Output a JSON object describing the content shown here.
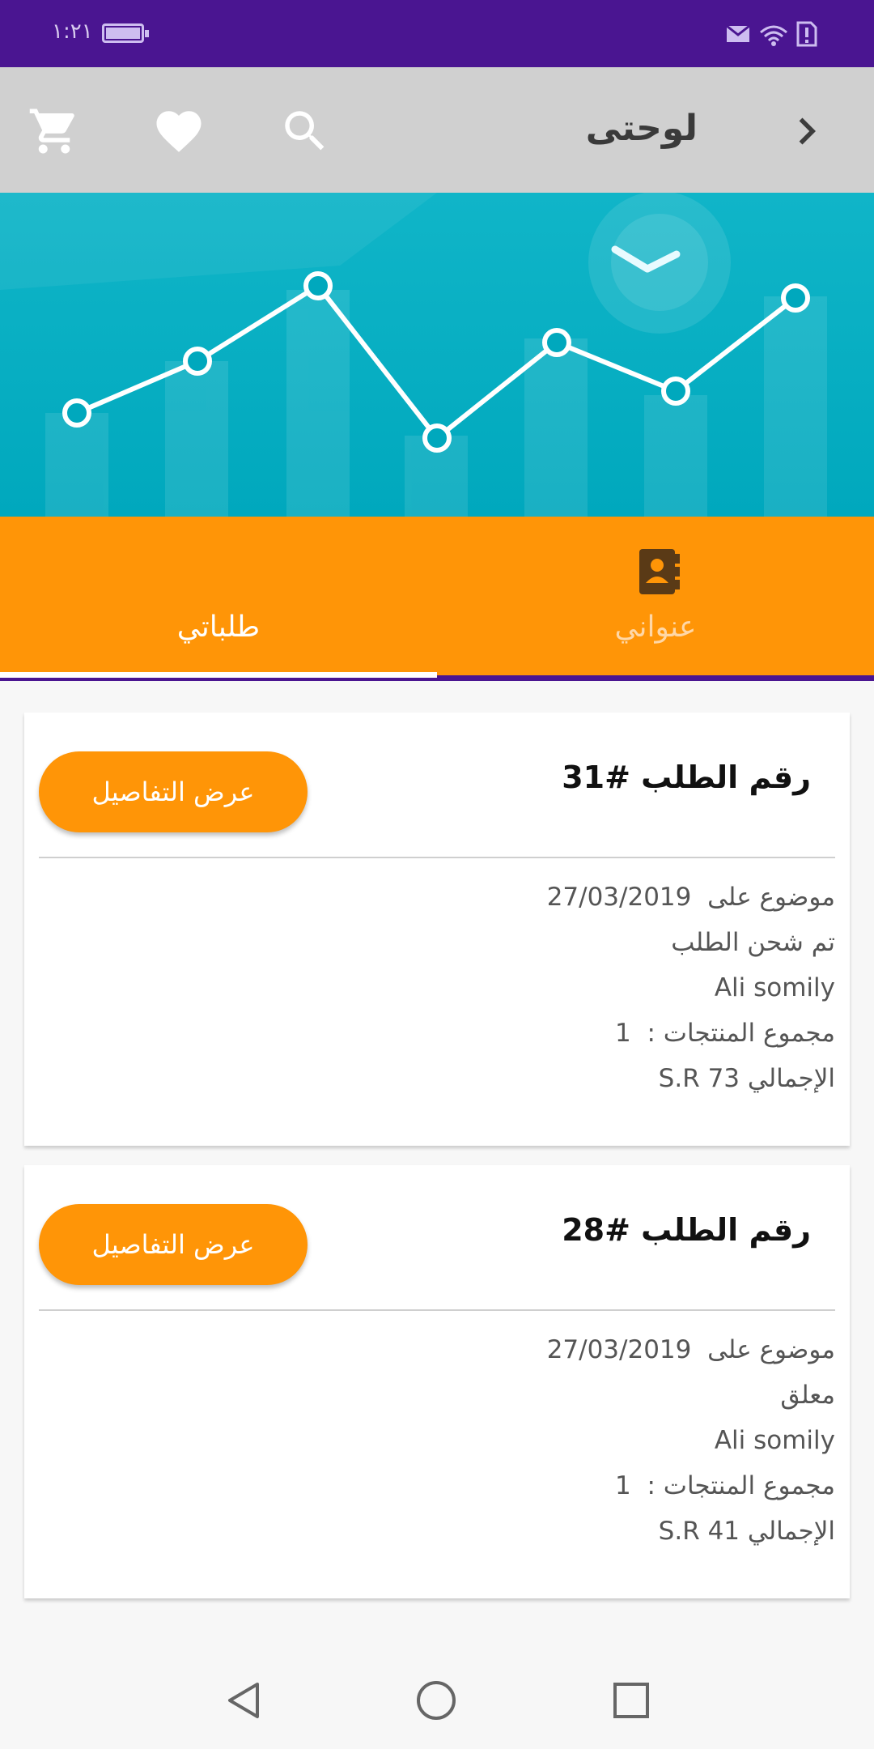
{
  "status_bar": {
    "time": "١:٢١"
  },
  "toolbar": {
    "title": "لوحتى"
  },
  "tabs": [
    {
      "label": "طلباتي",
      "active": true
    },
    {
      "label": "عنواني",
      "active": false
    }
  ],
  "orders": [
    {
      "title": "رقم الطلب #31",
      "button": "عرض التفاصيل",
      "date_label": "موضوع على",
      "date": "27/03/2019",
      "status": "تم شحن الطلب",
      "customer": "Ali somily",
      "count_label": "مجموع المنتجات  :",
      "count": "1",
      "total_label": "الإجمالي",
      "total": "S.R 73"
    },
    {
      "title": "رقم الطلب #28",
      "button": "عرض التفاصيل",
      "date_label": "موضوع على",
      "date": "27/03/2019",
      "status": "معلق",
      "customer": "Ali somily",
      "count_label": "مجموع المنتجات  :",
      "count": "1",
      "total_label": "الإجمالي",
      "total": "S.R 41"
    }
  ],
  "colors": {
    "status_bar": "#4a1591",
    "toolbar": "#d0d0d0",
    "accent": "#ff9507",
    "banner": "#00a8bd"
  },
  "icons": [
    "back-arrow-icon",
    "search-icon",
    "heart-icon",
    "cart-icon",
    "address-book-icon"
  ]
}
